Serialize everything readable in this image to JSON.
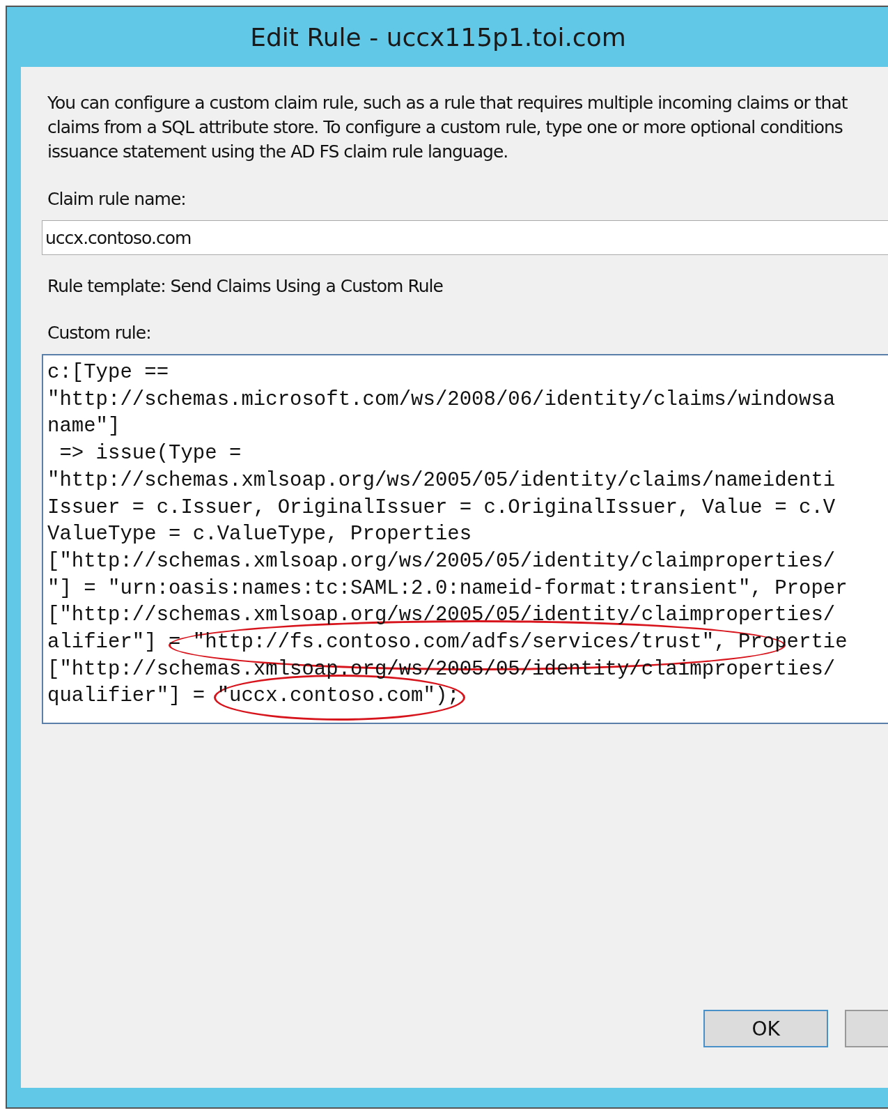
{
  "window": {
    "title": "Edit Rule - uccx115p1.toi.com"
  },
  "description": [
    "You can configure a custom claim rule, such as a rule that requires multiple incoming claims or that",
    "claims from a SQL attribute store. To configure a custom rule, type one or more optional conditions",
    "issuance statement using the AD FS claim rule language."
  ],
  "claim_rule_name": {
    "label": "Claim rule name:",
    "value": "uccx.contoso.com"
  },
  "rule_template": "Rule template: Send Claims Using a Custom Rule",
  "custom_rule": {
    "label": "Custom rule:",
    "lines": [
      "c:[Type ==",
      "\"http://schemas.microsoft.com/ws/2008/06/identity/claims/windowsa",
      "name\"]",
      " => issue(Type =",
      "\"http://schemas.xmlsoap.org/ws/2005/05/identity/claims/nameidenti",
      "Issuer = c.Issuer, OriginalIssuer = c.OriginalIssuer, Value = c.V",
      "ValueType = c.ValueType, Properties",
      "[\"http://schemas.xmlsoap.org/ws/2005/05/identity/claimproperties/",
      "\"] = \"urn:oasis:names:tc:SAML:2.0:nameid-format:transient\", Proper",
      "[\"http://schemas.xmlsoap.org/ws/2005/05/identity/claimproperties/",
      "alifier\"] = \"http://fs.contoso.com/adfs/services/trust\", Propertie",
      "[\"http://schemas.xmlsoap.org/ws/2005/05/identity/claimproperties/",
      "qualifier\"] = \"uccx.contoso.com\");"
    ]
  },
  "buttons": [
    {
      "label": "OK"
    }
  ]
}
